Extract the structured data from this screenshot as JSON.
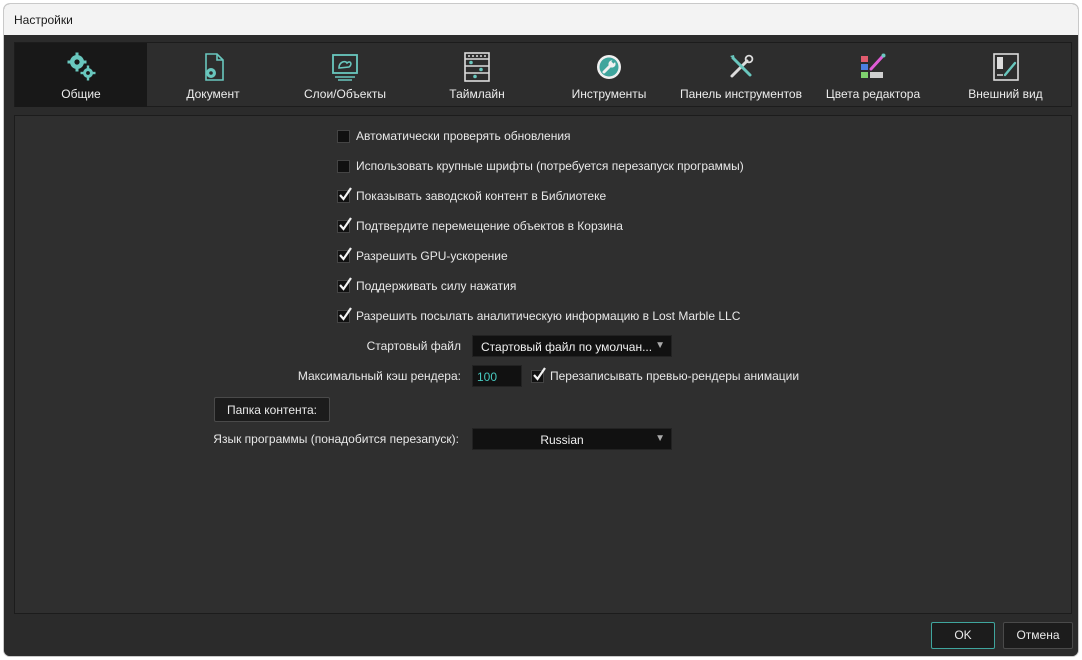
{
  "window": {
    "title": "Настройки"
  },
  "tabs": [
    {
      "label": "Общие",
      "icon": "gears-icon",
      "active": true
    },
    {
      "label": "Документ",
      "icon": "document-icon"
    },
    {
      "label": "Слои/Объекты",
      "icon": "layers-icon"
    },
    {
      "label": "Таймлайн",
      "icon": "timeline-icon"
    },
    {
      "label": "Инструменты",
      "icon": "wrench-icon"
    },
    {
      "label": "Панель инструментов",
      "icon": "tools-icon"
    },
    {
      "label": "Цвета редактора",
      "icon": "palette-icon"
    },
    {
      "label": "Внешний вид",
      "icon": "appearance-icon"
    }
  ],
  "checkboxes": [
    {
      "label": "Автоматически проверять обновления",
      "checked": false
    },
    {
      "label": "Использовать крупные шрифты (потребуется перезапуск программы)",
      "checked": false
    },
    {
      "label": "Показывать заводской контент в Библиотеке",
      "checked": true
    },
    {
      "label": "Подтвердите перемещение объектов в Корзина",
      "checked": true
    },
    {
      "label": "Разрешить GPU-ускорение",
      "checked": true
    },
    {
      "label": "Поддерживать силу нажатия",
      "checked": true
    },
    {
      "label": "Разрешить посылать аналитическую информацию в Lost Marble LLC",
      "checked": true
    }
  ],
  "startup_file": {
    "label": "Стартовый файл",
    "value": "Стартовый файл по умолчан..."
  },
  "render_cache": {
    "label": "Максимальный кэш рендера:",
    "value": "100",
    "overwrite_label": "Перезаписывать превью-рендеры анимации",
    "overwrite_checked": true
  },
  "content_folder_button": "Папка контента:",
  "language": {
    "label": "Язык программы (понадобится перезапуск):",
    "value": "Russian"
  },
  "footer": {
    "ok": "OK",
    "cancel": "Отмена"
  },
  "colors": {
    "accent": "#3fa59d",
    "icon_teal": "#69c7be",
    "background": "#2b2b2b",
    "active_tab": "#181818"
  }
}
